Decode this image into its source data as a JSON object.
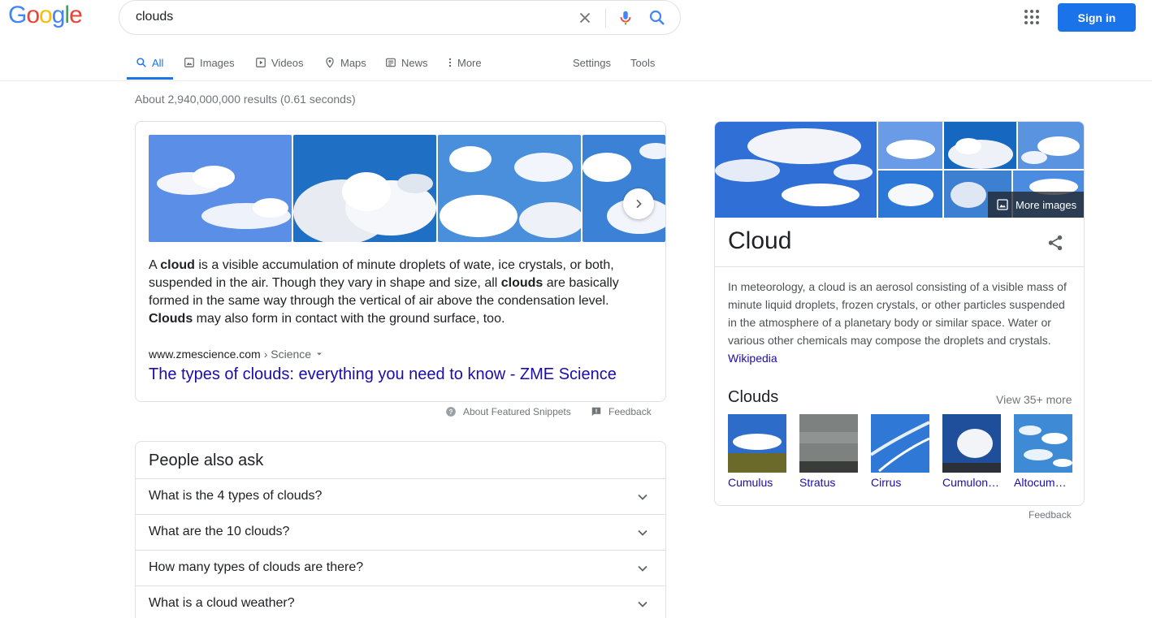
{
  "logo": {
    "letters": [
      "G",
      "o",
      "o",
      "g",
      "l",
      "e"
    ],
    "colors": [
      "#4285f4",
      "#ea4335",
      "#fbbc05",
      "#4285f4",
      "#34a853",
      "#ea4335"
    ]
  },
  "search": {
    "query": "clouds"
  },
  "header": {
    "signin_label": "Sign in"
  },
  "tabs": [
    {
      "label": "All",
      "icon": "search-icon",
      "active": true
    },
    {
      "label": "Images",
      "icon": "image-icon"
    },
    {
      "label": "Videos",
      "icon": "video-icon"
    },
    {
      "label": "Maps",
      "icon": "map-pin-icon"
    },
    {
      "label": "News",
      "icon": "news-icon"
    },
    {
      "label": "More",
      "icon": "more-vert-icon"
    },
    {
      "label": "Settings"
    },
    {
      "label": "Tools"
    }
  ],
  "stats": "About 2,940,000,000 results (0.61 seconds)",
  "snippet": {
    "text_parts": {
      "p1": "A ",
      "b1": "cloud",
      "p2": " is a visible accumulation of minute droplets of wate, ice crystals, or both, suspended in the air. Though they vary in shape and size, all ",
      "b2": "clouds",
      "p3": " are basically formed in the same way through the vertical of air above the condensation level. ",
      "b3": "Clouds",
      "p4": " may also form in contact with the ground surface, too."
    },
    "cite_domain": "www.zmescience.com",
    "cite_crumb": " › Science",
    "link_title": "The types of clouds: everything you need to know - ZME Science"
  },
  "snippet_meta": {
    "about": "About Featured Snippets",
    "feedback": "Feedback"
  },
  "paa": {
    "title": "People also ask",
    "questions": [
      "What is the 4 types of clouds?",
      "What are the 10 clouds?",
      "How many types of clouds are there?",
      "What is a cloud weather?"
    ]
  },
  "kp": {
    "more_images": "More images",
    "title": "Cloud",
    "description": "In meteorology, a cloud is an aerosol consisting of a visible mass of minute liquid droplets, frozen crystals, or other particles suspended in the atmosphere of a planetary body or similar space. Water or various other chemicals may compose the droplets and crystals.",
    "wiki": "Wikipedia",
    "clouds_heading": "Clouds",
    "view_more": "View 35+ more",
    "types": [
      "Cumulus",
      "Stratus",
      "Cirrus",
      "Cumulon…",
      "Altocum…"
    ],
    "feedback": "Feedback"
  },
  "colors": {
    "accent": "#1a73e8",
    "link": "#1a0dab",
    "sky": "#3f7fd8"
  }
}
